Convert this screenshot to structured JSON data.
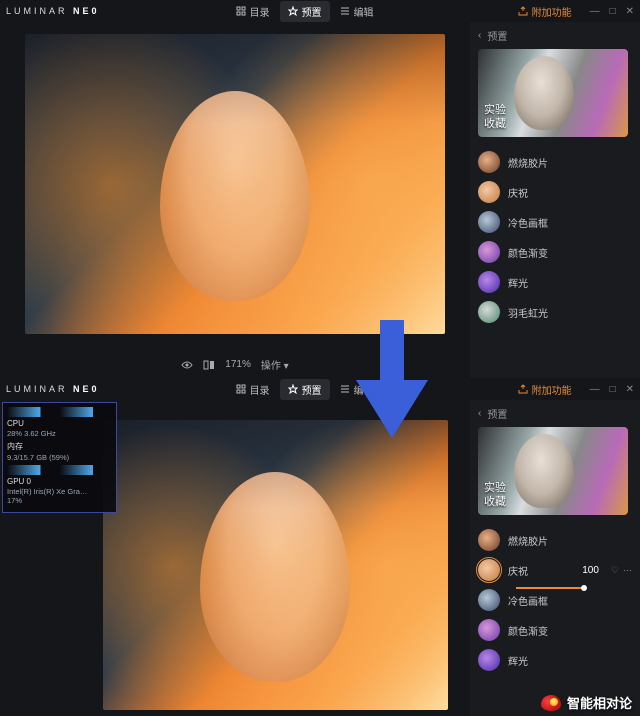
{
  "app": {
    "logo1": "LUMINAR",
    "logo2": "NE0"
  },
  "toolbar": {
    "catalog": "目录",
    "presets": "预置",
    "edit": "编辑",
    "addon": "附加功能"
  },
  "status": {
    "zoom": "171%",
    "action": "操作"
  },
  "side": {
    "header": "预置",
    "thumb_l1": "实验",
    "thumb_l2": "收藏",
    "presets": [
      {
        "label": "燃烧胶片"
      },
      {
        "label": "庆祝"
      },
      {
        "label": "冷色画框"
      },
      {
        "label": "颜色渐变"
      },
      {
        "label": "辉光"
      },
      {
        "label": "羽毛虹光"
      }
    ],
    "selected_value": "100"
  },
  "perf": {
    "cpu_label": "CPU",
    "cpu_line": "28% 3.62 GHz",
    "mem_label": "内存",
    "mem_line": "9.3/15.7 GB (59%)",
    "gpu_label": "GPU 0",
    "gpu_line1": "Intel(R) Iris(R) Xe Gra…",
    "gpu_line2": "17%"
  },
  "watermark": "智能相对论"
}
